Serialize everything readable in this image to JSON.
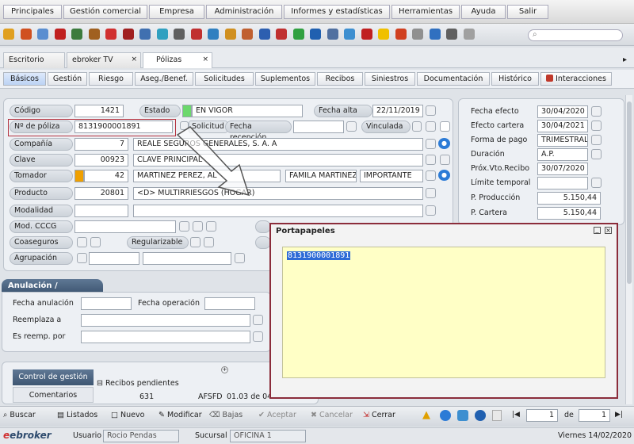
{
  "menubar": {
    "items": [
      "Principales",
      "Gestión comercial",
      "Empresa",
      "Administración",
      "Informes y estadísticas",
      "Herramientas",
      "Ayuda",
      "Salir"
    ]
  },
  "toolbar": {
    "colors": [
      "#e0a020",
      "#d05020",
      "#5a8ed0",
      "#c02020",
      "#3d7b3d",
      "#a06020",
      "#d03030",
      "#a02020",
      "#4070b0",
      "#30a0c0",
      "#606060",
      "#c03030",
      "#3080c0",
      "#d09020",
      "#c06030",
      "#2d5fb0",
      "#c03030",
      "#30a040",
      "#2060b0",
      "#5070a0",
      "#3d8fd0",
      "#c02020",
      "#f0c000",
      "#d04020",
      "#909090",
      "#3070c0",
      "#606060",
      "#a0a0a0"
    ]
  },
  "window_tabs": [
    "Escritorio",
    "ebroker TV",
    "Pólizas"
  ],
  "sub_tabs": [
    "Básicos",
    "Gestión",
    "Riesgo",
    "Aseg./Benef.",
    "Solicitudes",
    "Suplementos",
    "Recibos",
    "Siniestros",
    "Documentación",
    "Histórico",
    "Interacciones"
  ],
  "policy": {
    "codigo_label": "Código",
    "codigo": "1421",
    "estado_label": "Estado",
    "estado": "EN VIGOR",
    "fecha_alta_label": "Fecha alta",
    "fecha_alta": "22/11/2019",
    "num_poliza_label": "Nº de póliza",
    "num_poliza": "8131900001891",
    "solicitud_label": "Solicitud",
    "fecha_recepcion_label": "Fecha recepción",
    "vinculada_label": "Vinculada",
    "compania_label": "Compañía",
    "compania_code": "7",
    "compania": "REALE SEGUROS GENERALES, S. A. A",
    "clave_label": "Clave",
    "clave_code": "00923",
    "clave": "CLAVE PRINCIPAL",
    "tomador_label": "Tomador",
    "tomador_code": "42",
    "tomador": "MARTINEZ PEREZ, AL",
    "tomador_family": "FAMILA MARTINEZ",
    "tomador_level": "IMPORTANTE",
    "producto_label": "Producto",
    "producto_code": "20801",
    "producto": "<D> MULTIRRIESGOS (HOGAR)",
    "modalidad_label": "Modalidad",
    "mod_cccg_label": "Mod. CCCG",
    "coaseguros_label": "Coaseguros",
    "regularizable_label": "Regularizable",
    "agrupacion_label": "Agrupación"
  },
  "right_panel": {
    "fecha_efecto_label": "Fecha efecto",
    "fecha_efecto": "30/04/2020",
    "efecto_cartera_label": "Efecto cartera",
    "efecto_cartera": "30/04/2021",
    "forma_pago_label": "Forma de pago",
    "forma_pago": "TRIMESTRAL",
    "duracion_label": "Duración",
    "duracion": "A.P.",
    "prox_vto_label": "Próx.Vto.Recibo",
    "prox_vto": "30/07/2020",
    "limite_label": "Límite temporal",
    "p_produccion_label": "P. Producción",
    "p_produccion": "5.150,44",
    "p_cartera_label": "P. Cartera",
    "p_cartera": "5.150,44"
  },
  "anulacion": {
    "title": "Anulación / Reemplazo",
    "fecha_anulacion_label": "Fecha anulación",
    "fecha_operacion_label": "Fecha operación",
    "reemplaza_label": "Reemplaza a",
    "es_reemp_label": "Es reemp. por"
  },
  "gestion": {
    "tab_control": "Control de gestión",
    "tab_comentarios": "Comentarios",
    "recibos_label": "Recibos pendientes",
    "row_num": "631",
    "row_code": "AFSFD",
    "row_date": "01.03 de 04"
  },
  "popup": {
    "title": "Portapapeles",
    "content": "8131900001891"
  },
  "bottom": {
    "buscar": "Buscar",
    "listados": "Listados",
    "nuevo": "Nuevo",
    "modificar": "Modificar",
    "bajas": "Bajas",
    "aceptar": "Aceptar",
    "cancelar": "Cancelar",
    "cerrar": "Cerrar",
    "page": "1",
    "de": "de",
    "total": "1"
  },
  "status": {
    "brand": "ebroker",
    "usuario_label": "Usuario",
    "usuario": "Rocio Pendas",
    "sucursal_label": "Sucursal",
    "sucursal": "OFICINA 1",
    "date": "Viernes 14/02/2020"
  }
}
